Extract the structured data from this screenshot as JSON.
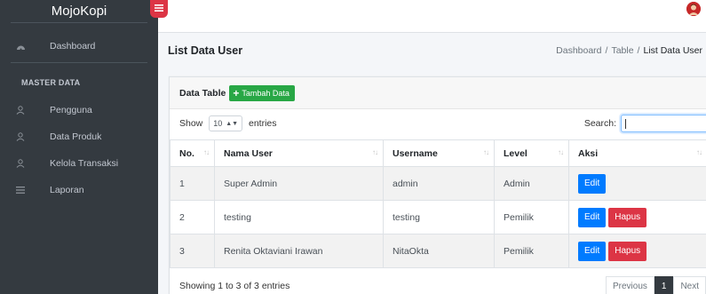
{
  "sidebar": {
    "brand": "MojoKopi",
    "items": [
      {
        "label": "Dashboard",
        "icon": "dashboard-icon"
      },
      {
        "label": "Pengguna",
        "icon": "user-icon"
      },
      {
        "label": "Data Produk",
        "icon": "user-icon"
      },
      {
        "label": "Kelola Transaksi",
        "icon": "user-icon"
      },
      {
        "label": "Laporan",
        "icon": "list-icon"
      }
    ],
    "section_header": "MASTER DATA"
  },
  "header": {
    "title": "List Data User",
    "breadcrumb": [
      "Dashboard",
      "Table",
      "List Data User"
    ]
  },
  "card": {
    "title": "Data Table",
    "add_button": "Tambah Data",
    "show_label": "Show",
    "entries_label": "entries",
    "page_length": "10",
    "search_label": "Search:",
    "search_value": ""
  },
  "table": {
    "columns": [
      "No.",
      "Nama User",
      "Username",
      "Level",
      "Aksi"
    ],
    "rows": [
      {
        "no": "1",
        "nama": "Super Admin",
        "username": "admin",
        "level": "Admin"
      },
      {
        "no": "2",
        "nama": "testing",
        "username": "testing",
        "level": "Pemilik"
      },
      {
        "no": "3",
        "nama": "Renita Oktaviani Irawan",
        "username": "NitaOkta",
        "level": "Pemilik"
      }
    ],
    "edit_label": "Edit",
    "delete_label": "Hapus"
  },
  "footer": {
    "info": "Showing 1 to 3 of 3 entries",
    "previous": "Previous",
    "page": "1",
    "next": "Next"
  },
  "colors": {
    "sidebar": "#343a40",
    "add": "#28a745",
    "edit": "#007bff",
    "delete": "#dc3545"
  }
}
